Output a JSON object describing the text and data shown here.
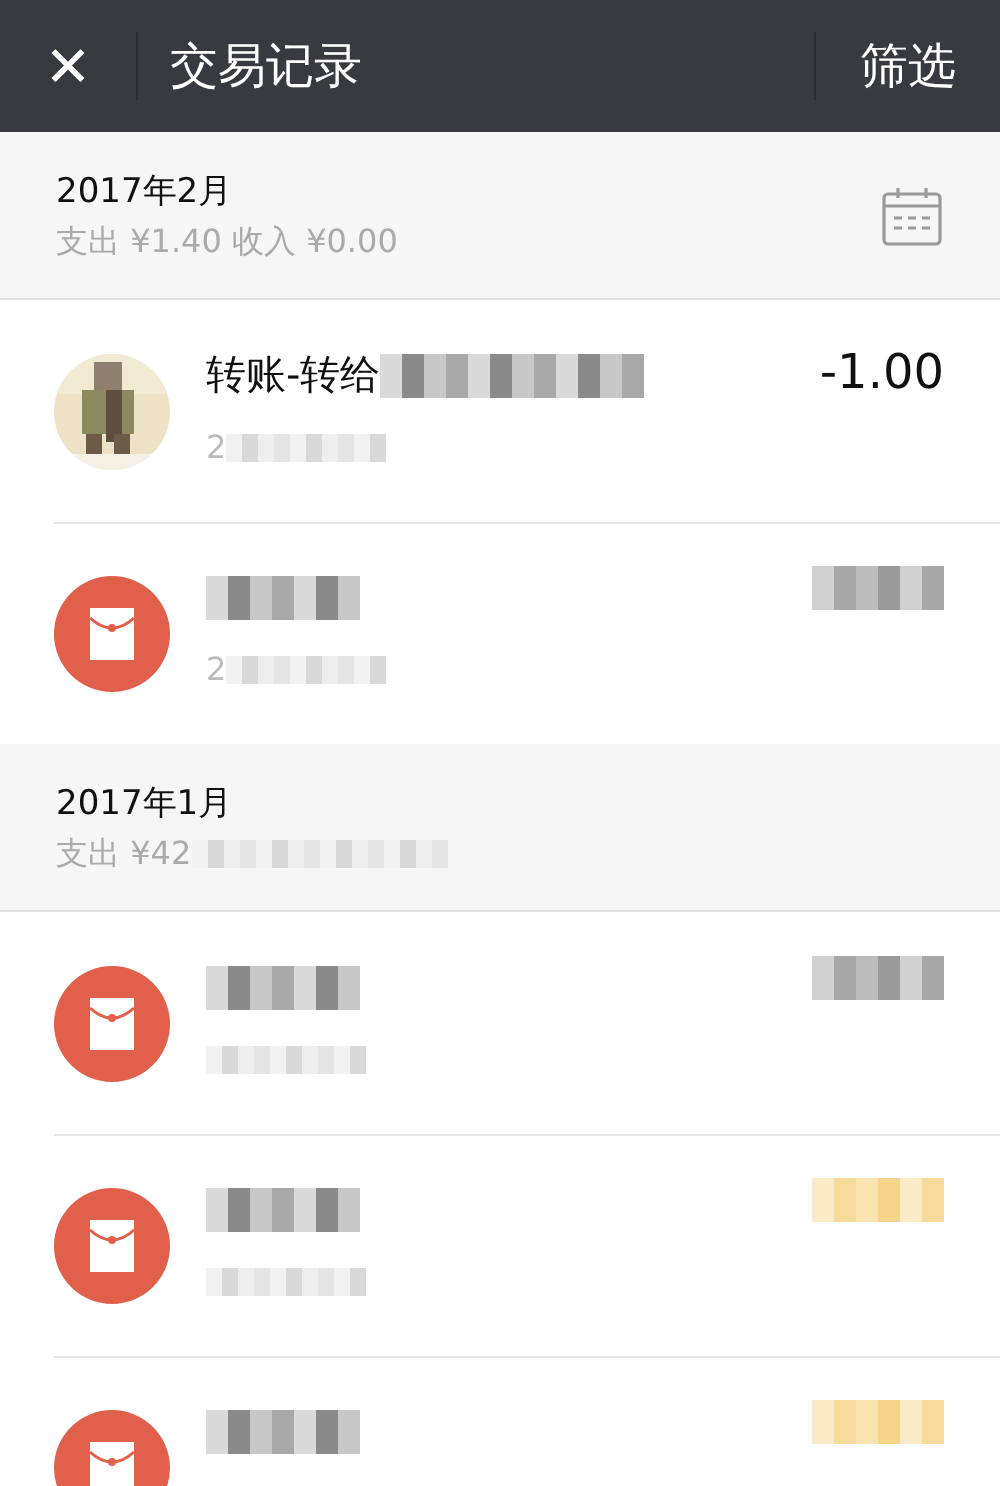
{
  "top_bar": {
    "close": "✕",
    "title": "交易记录",
    "action": "筛选"
  },
  "months": [
    {
      "label": "2017年2月",
      "summary": "支出 ¥1.40 收入 ¥0.00",
      "calendar": true,
      "items": [
        {
          "kind": "transfer",
          "title": "转账-转给",
          "title_redacted": true,
          "subtitle": "2",
          "subtitle_redacted": true,
          "amount": "-1.00"
        },
        {
          "kind": "packet",
          "title_redacted": true,
          "subtitle": "2",
          "subtitle_redacted": true,
          "amount_redacted": true,
          "color": "#9a9a9a"
        }
      ]
    },
    {
      "label": "2017年1月",
      "summary": "支出 ¥42",
      "summary_redacted": true,
      "items": [
        {
          "kind": "packet",
          "title_redacted": true,
          "subtitle_redacted": true,
          "amount_redacted": true,
          "color": "#9a9a9a"
        },
        {
          "kind": "packet",
          "title_redacted": true,
          "subtitle_redacted": true,
          "amount_redacted": true,
          "color": "#f5d58a"
        },
        {
          "kind": "packet",
          "title_redacted": true,
          "amount_redacted": true,
          "color": "#f5d58a"
        }
      ]
    }
  ]
}
